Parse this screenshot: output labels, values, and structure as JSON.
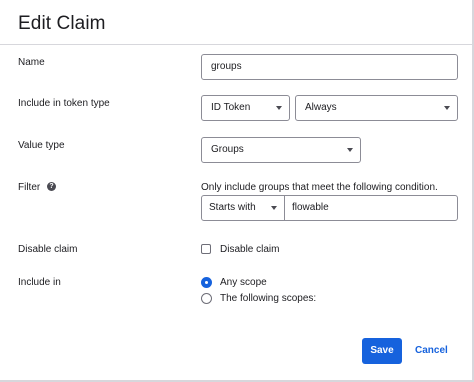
{
  "dialog": {
    "title": "Edit Claim"
  },
  "name": {
    "label": "Name",
    "value": "groups"
  },
  "token": {
    "label": "Include in token type",
    "token_type": "ID Token",
    "frequency": "Always"
  },
  "value_type": {
    "label": "Value type",
    "value": "Groups"
  },
  "filter": {
    "label": "Filter",
    "help": "Only include groups that meet the following condition.",
    "operator": "Starts with",
    "value": "flowable"
  },
  "disable_claim": {
    "label": "Disable claim",
    "checkbox_label": "Disable claim",
    "checked": false
  },
  "include_in": {
    "label": "Include in",
    "options": [
      {
        "label": "Any scope",
        "selected": true
      },
      {
        "label": "The following scopes:",
        "selected": false
      }
    ]
  },
  "actions": {
    "save": "Save",
    "cancel": "Cancel"
  },
  "colors": {
    "primary": "#1662dd",
    "border": "#8c8c96",
    "text": "#1d1d21"
  }
}
